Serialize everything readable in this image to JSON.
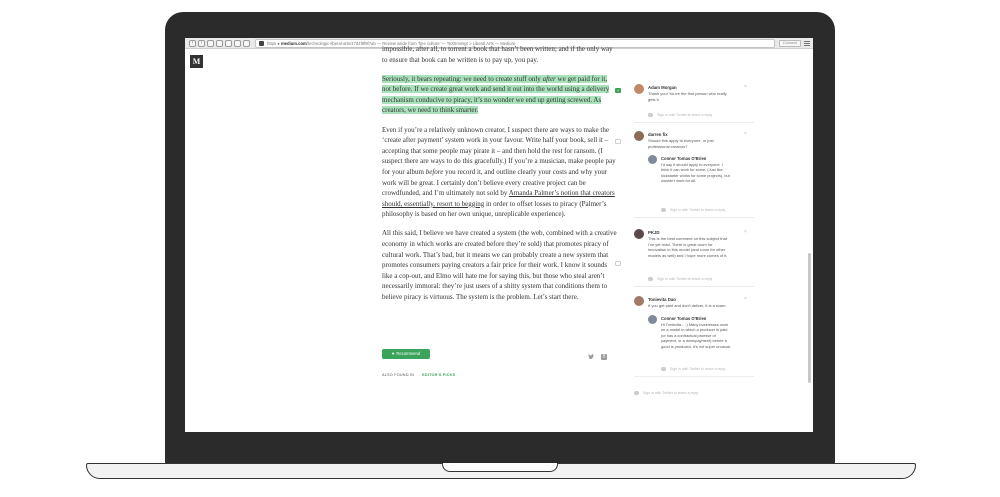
{
  "browser": {
    "url_host": "https",
    "url_host2": "medium.com",
    "url_path": "/technologic-liberal-arts/47d4f8f8f7ab — Review aside from 'free culture' — TeXtImmigr > Liberal Arts — Medium",
    "reader_label": "Connect"
  },
  "logo": {
    "letter": "M"
  },
  "article": {
    "p1": "impossible, after all, to torrent a book that hasn’t been written; and if the only way to ensure that book can be written is to pay up, you pay.",
    "p2_a": "Seriously, it bears repeating: we need to create stuff only ",
    "p2_em": "after",
    "p2_b": " we get paid for it, not before. If we create great work and send it out into the world using a delivery mechanism conducive to piracy, it’s no wonder we end up getting screwed. As creators, we need to think smarter.",
    "p3_a": "Even if you’re a relatively unknown creator, I suspect there are ways to make the ‘create after payment’ system work in your favour. Write half your book, sell it – accepting that some people may pirate it – and then hold the rest for ransom. (I suspect there are ways to do this gracefully.) If you’re a musician, make people pay for your album ",
    "p3_em": "before",
    "p3_b": " you record it, and outline clearly your costs and why your work will be great. I certainly don’t believe every creative project can be crowdfunded, and I’m ultimately not sold by ",
    "p3_link": "Amanda Palmer’s notion that creators should, essentially, resort to begging",
    "p3_c": " in order to offset losses to piracy (Palmer’s philosophy is based on her own unique, unreplicable experience).",
    "p4": "All this said, I believe we have created a system (the web, combined with a creative economy in which works are created before they’re sold) that promotes piracy of cultural work. That’s bad, but it means we can probably create a new system that promotes consumers paying creators a fair price for their work. I know it sounds like a cop-out, and Elmo will hate me for saying this, but those who steal aren’t necessarily immoral: they’re just users of a shitty system that conditions them to believe piracy is virtuous. The system is the problem. Let’s start there."
  },
  "footer": {
    "recommend_label": "Recommend",
    "also_found_label": "ALSO FOUND IN",
    "collection_label": "EDITOR'S PICKS"
  },
  "notes": [
    {
      "name": "Adam Morgan",
      "text": "Thank you! You're the first person who really gets it.",
      "reply_prompt": "Sign in with Twitter to leave a reply"
    },
    {
      "name": "darren fix",
      "text": "Should this apply to everyone, or just professional creators?",
      "reply_name": "Connor Tomas O'Brien",
      "reply_text": "I'd say it should apply to everyone. I think it can work for some, (Just like kickstarter works for some projects), but wouldn't work for all.",
      "reply_prompt": "Sign in with Twitter to leave a reply"
    },
    {
      "name": "PKJD",
      "text": "This is the best comment on this subject that I've yet read. There is great room for innovation in this model (and room for other models as well) and I hope more comes of it.",
      "reply_prompt": "Sign in with Twitter to leave a reply"
    },
    {
      "name": "Tonievita Dao",
      "text": "If you get paid and don't deliver, it is a scam",
      "reply_name": "Connor Tomas O'Brien",
      "reply_text": "Hi Tonievita... :) Many businesses work on a model in which a producer is paid (or has a contractual promise of payment, or a downpayment) before a good is produced. It's not super unusual.",
      "reply_prompt": "Sign in with Twitter to leave a reply"
    }
  ],
  "bottom_reply_prompt": "Sign in with Twitter to leave a reply",
  "colors": {
    "accent": "#3ca35a",
    "highlight": "#a9e2ba",
    "bezel": "#2b2b2b"
  }
}
